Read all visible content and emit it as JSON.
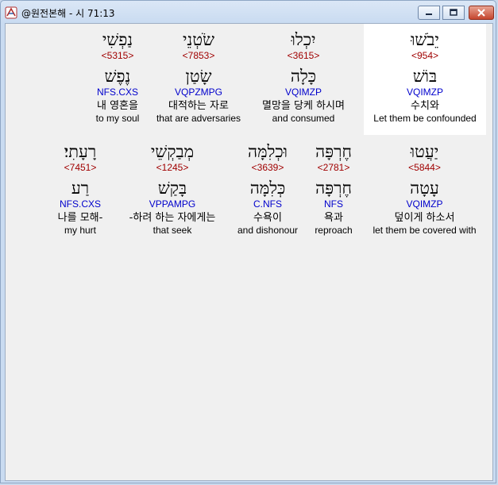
{
  "window": {
    "title": "@원전본해 - 시 71:13"
  },
  "words": [
    {
      "hebrew": "יֵבֹשׁוּ",
      "strong": "<954>",
      "lemma": "בּוֹשׁ",
      "morph": "VQIMZP",
      "korean": "수치와",
      "english": "Let them be confounded",
      "selected": true
    },
    {
      "hebrew": "יִכְלוּ",
      "strong": "<3615>",
      "lemma": "כָּלָה",
      "morph": "VQIMZP",
      "korean": "멸망을 당케 하시며",
      "english": "and consumed",
      "selected": false
    },
    {
      "hebrew": "שֹׂטְנֵי",
      "strong": "<7853>",
      "lemma": "שָׂטַן",
      "morph": "VQPZMPG",
      "korean": "대적하는 자로",
      "english": "that are adversaries",
      "selected": false
    },
    {
      "hebrew": "נַפְשִׁי",
      "strong": "<5315>",
      "lemma": "נֶפֶשׁ",
      "morph": "NFS.CXS",
      "korean": "내 영혼을",
      "english": "to my soul",
      "selected": false
    },
    {
      "hebrew": "יַעֲטוּ",
      "strong": "<5844>",
      "lemma": "עָטָה",
      "morph": "VQIMZP",
      "korean": "덮이게 하소서",
      "english": "let them be covered with",
      "selected": false
    },
    {
      "hebrew": "חֶרְפָּה",
      "strong": "<2781>",
      "lemma": "חֶרְפָּה",
      "morph": "NFS",
      "korean": "욕과",
      "english": "reproach",
      "selected": false
    },
    {
      "hebrew": "וּכְלִמָּה",
      "strong": "<3639>",
      "lemma": "כְּלִמָּה",
      "morph": "C.NFS",
      "korean": "수욕이",
      "english": "and dishonour",
      "selected": false
    },
    {
      "hebrew": "מְבַקְשֵׁי",
      "strong": "<1245>",
      "lemma": "בָּקַשׁ",
      "morph": "VPPAMPG",
      "korean": "-하려 하는 자에게는",
      "english": "that seek",
      "selected": false
    },
    {
      "hebrew": "רָעָתִי׃",
      "strong": "<7451>",
      "lemma": "רַע",
      "morph": "NFS.CXS",
      "korean": "나를 모해-",
      "english": "my hurt",
      "selected": false
    }
  ]
}
